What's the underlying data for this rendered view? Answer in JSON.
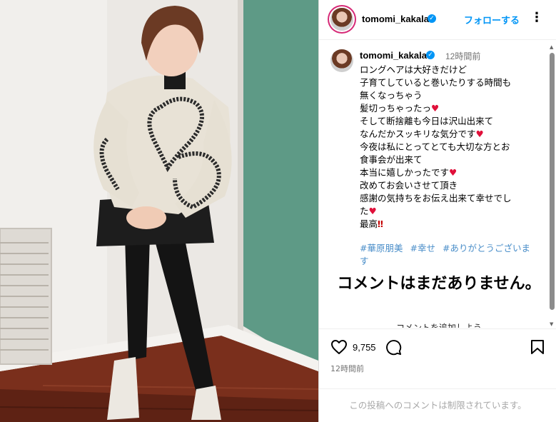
{
  "post": {
    "username": "tomomi_kakala",
    "follow_label": "フォローする",
    "more_label": "⋮",
    "time_ago": "12時間前"
  },
  "caption": {
    "lines": [
      "ロングヘアは大好きだけど",
      "子育てしていると巻いたりする時間も",
      "無くなっちゃう",
      "髪切っちゃったっ",
      "そして断捨離も今日は沢山出来て",
      "なんだかスッキリな気分です",
      "今夜は私にとってとても大切な方とお",
      "食事会が出来て",
      "本当に嬉しかったです",
      "改めてお会いさせて頂き",
      "感謝の気持ちをお伝え出来て幸せでし",
      "た",
      "最高"
    ]
  },
  "hashtags": [
    "#華原朋美",
    "#幸せ",
    "#ありがとうございます"
  ],
  "comments": {
    "empty_title": "コメントはまだありません。",
    "add_prompt": "コメントを追加しよう"
  },
  "actions": {
    "like_count": "9,755",
    "post_time": "12時間前"
  },
  "footer": {
    "restricted_text": "この投稿へのコメントは制限されています。"
  },
  "colors": {
    "link_blue": "#0095f6",
    "hashtag_blue": "#4a8ec9",
    "heart_red": "#e0103a",
    "wall_green": "#5e9a86"
  },
  "icons": [
    "verified-badge-icon",
    "heart-icon",
    "comment-icon",
    "bookmark-icon",
    "more-options-icon"
  ]
}
